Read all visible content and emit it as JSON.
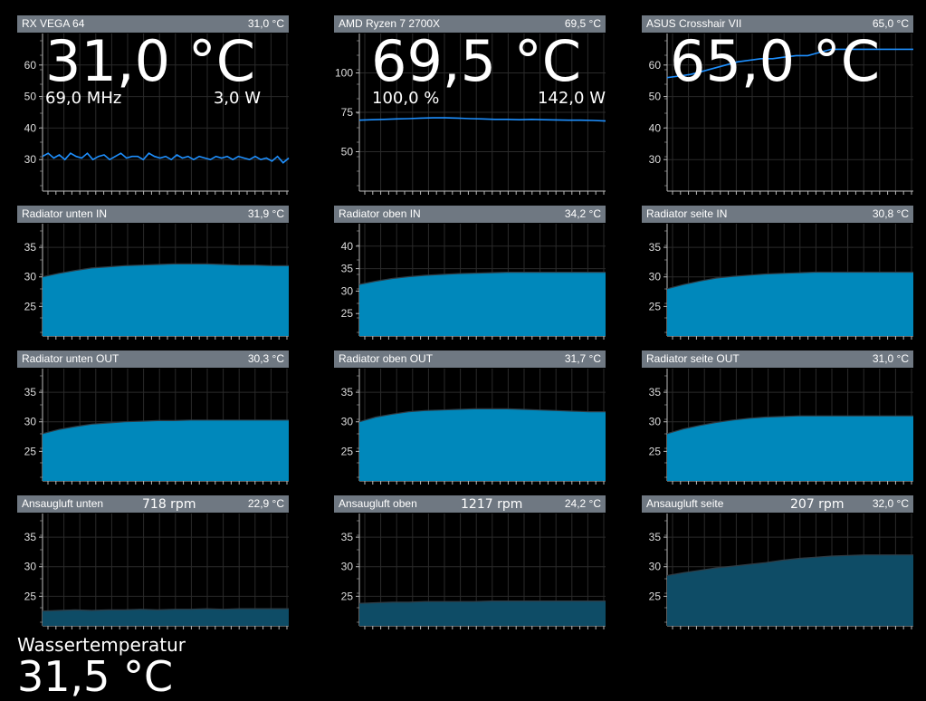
{
  "colors": {
    "header_bg": "#6f7882",
    "line": "#1e90ff",
    "area_bright": "#0088bb",
    "area_dark": "#0e4c66"
  },
  "panels": [
    {
      "title": "RX VEGA 64",
      "value": "31,0 °C",
      "big_value": "31,0 °C",
      "sub_left": "69,0 MHz",
      "sub_right": "3,0 W",
      "chart_data": {
        "type": "line",
        "ylim": [
          20,
          70
        ],
        "ticks": [
          "30",
          "40",
          "50",
          "60"
        ],
        "values": [
          31,
          32,
          30.5,
          31.5,
          30,
          32,
          31,
          30.5,
          32,
          30,
          31,
          31.5,
          30,
          31,
          32,
          30.5,
          31,
          31,
          30,
          32,
          31,
          30.5,
          31,
          30,
          31.5,
          30.5,
          31,
          30,
          31,
          30.5,
          30,
          31,
          30.5,
          31,
          30,
          31,
          30.5,
          30,
          31,
          30,
          30.5,
          29.5,
          31,
          29,
          30.5
        ]
      }
    },
    {
      "title": "AMD Ryzen 7 2700X",
      "value": "69,5 °C",
      "big_value": "69,5 °C",
      "sub_left": "100,0 %",
      "sub_right": "142,0 W",
      "chart_data": {
        "type": "line",
        "ylim": [
          25,
          125
        ],
        "ticks": [
          "50",
          "75",
          "100"
        ],
        "values": [
          70,
          70.3,
          70.5,
          70.8,
          71,
          71.3,
          71.5,
          71.5,
          71.3,
          71,
          70.8,
          70.5,
          70.5,
          70.3,
          70.5,
          70.3,
          70.2,
          70,
          70,
          69.8,
          69.5
        ]
      }
    },
    {
      "title": "ASUS Crosshair VII",
      "value": "65,0 °C",
      "big_value": "65,0 °C",
      "chart_data": {
        "type": "line",
        "ylim": [
          20,
          70
        ],
        "ticks": [
          "30",
          "40",
          "50",
          "60"
        ],
        "values": [
          56,
          56.5,
          57,
          58,
          59,
          60,
          61,
          61.5,
          62,
          62,
          62.5,
          63,
          63,
          64,
          65,
          65,
          65,
          65,
          65,
          65,
          65,
          65
        ]
      }
    },
    {
      "title": "Radiator unten IN",
      "value": "31,9 °C",
      "chart_data": {
        "type": "area",
        "ylim": [
          20,
          39
        ],
        "ticks": [
          "25",
          "30",
          "35"
        ],
        "values": [
          30,
          30.6,
          31.1,
          31.5,
          31.7,
          31.9,
          32,
          32.1,
          32.2,
          32.2,
          32.2,
          32.1,
          32,
          32,
          31.9,
          31.9
        ]
      }
    },
    {
      "title": "Radiator oben IN",
      "value": "34,2 °C",
      "chart_data": {
        "type": "area",
        "ylim": [
          20,
          45
        ],
        "ticks": [
          "25",
          "30",
          "35",
          "40"
        ],
        "values": [
          31.5,
          32.2,
          32.8,
          33.2,
          33.5,
          33.7,
          33.9,
          34,
          34.1,
          34.2,
          34.2,
          34.2,
          34.2,
          34.2,
          34.2,
          34.2
        ]
      }
    },
    {
      "title": "Radiator seite IN",
      "value": "30,8 °C",
      "chart_data": {
        "type": "area",
        "ylim": [
          20,
          39
        ],
        "ticks": [
          "25",
          "30",
          "35"
        ],
        "values": [
          28,
          28.7,
          29.3,
          29.8,
          30.1,
          30.3,
          30.5,
          30.6,
          30.7,
          30.8,
          30.8,
          30.8,
          30.8,
          30.8,
          30.8,
          30.8
        ]
      }
    },
    {
      "title": "Radiator unten OUT",
      "value": "30,3 °C",
      "chart_data": {
        "type": "area",
        "ylim": [
          20,
          39
        ],
        "ticks": [
          "25",
          "30",
          "35"
        ],
        "values": [
          28,
          28.7,
          29.2,
          29.6,
          29.8,
          30,
          30.1,
          30.2,
          30.2,
          30.3,
          30.3,
          30.3,
          30.3,
          30.3,
          30.3,
          30.3
        ]
      }
    },
    {
      "title": "Radiator oben OUT",
      "value": "31,7 °C",
      "chart_data": {
        "type": "area",
        "ylim": [
          20,
          39
        ],
        "ticks": [
          "25",
          "30",
          "35"
        ],
        "values": [
          30,
          30.8,
          31.3,
          31.7,
          31.9,
          32,
          32.1,
          32.2,
          32.2,
          32.2,
          32.1,
          32,
          31.9,
          31.8,
          31.7,
          31.7
        ]
      }
    },
    {
      "title": "Radiator seite OUT",
      "value": "31,0 °C",
      "chart_data": {
        "type": "area",
        "ylim": [
          20,
          39
        ],
        "ticks": [
          "25",
          "30",
          "35"
        ],
        "values": [
          28,
          28.8,
          29.4,
          29.9,
          30.3,
          30.6,
          30.8,
          30.9,
          31,
          31,
          31,
          31,
          31,
          31,
          31,
          31
        ]
      }
    },
    {
      "title": "Ansaugluft unten",
      "rpm": "718 rpm",
      "value": "22,9 °C",
      "chart_data": {
        "type": "area_dark",
        "ylim": [
          20,
          39
        ],
        "ticks": [
          "25",
          "30",
          "35"
        ],
        "values": [
          22.5,
          22.6,
          22.7,
          22.6,
          22.7,
          22.7,
          22.8,
          22.7,
          22.8,
          22.8,
          22.9,
          22.8,
          22.9,
          22.9,
          22.9,
          22.9
        ]
      }
    },
    {
      "title": "Ansaugluft oben",
      "rpm": "1217 rpm",
      "value": "24,2 °C",
      "chart_data": {
        "type": "area_dark",
        "ylim": [
          20,
          39
        ],
        "ticks": [
          "25",
          "30",
          "35"
        ],
        "values": [
          23.8,
          23.9,
          24,
          24,
          24.1,
          24.1,
          24.1,
          24.1,
          24.2,
          24.2,
          24.2,
          24.2,
          24.2,
          24.2,
          24.2,
          24.2
        ]
      }
    },
    {
      "title": "Ansaugluft seite",
      "rpm": "207 rpm",
      "value": "32,0 °C",
      "chart_data": {
        "type": "area_dark",
        "ylim": [
          20,
          39
        ],
        "ticks": [
          "25",
          "30",
          "35"
        ],
        "values": [
          28.5,
          29,
          29.4,
          29.8,
          30.1,
          30.4,
          30.7,
          31.1,
          31.4,
          31.6,
          31.8,
          31.9,
          32,
          32,
          32,
          32
        ]
      }
    }
  ],
  "footer": {
    "label": "Wassertemperatur",
    "value": "31,5 °C"
  }
}
